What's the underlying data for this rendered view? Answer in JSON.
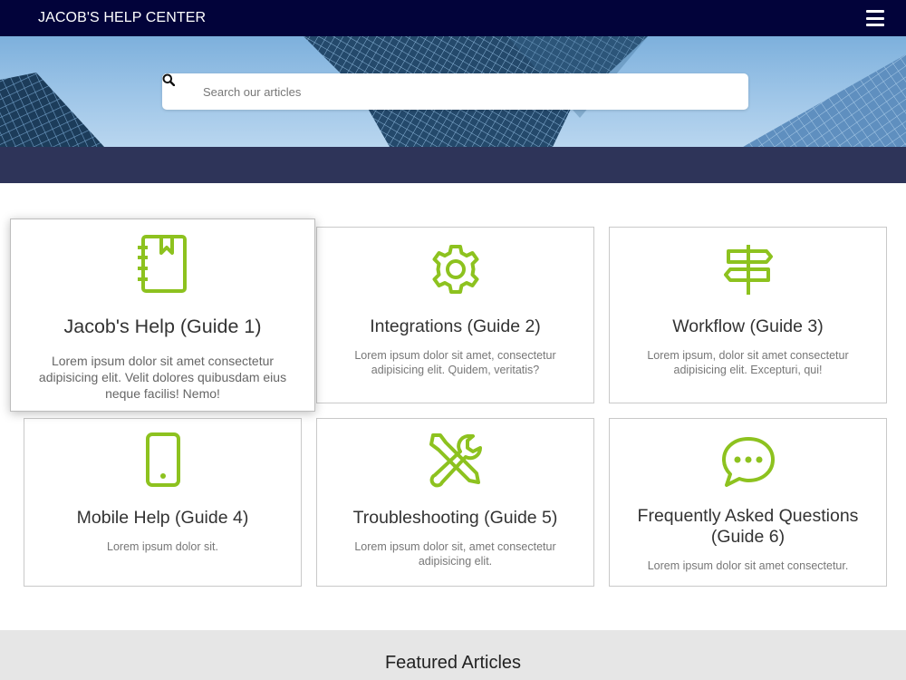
{
  "header": {
    "brand": "JACOB'S HELP CENTER",
    "menu_icon": "hamburger-menu-icon"
  },
  "search": {
    "placeholder": "Search our articles",
    "icon": "search-icon"
  },
  "colors": {
    "accent": "#8dc21f",
    "topbar": "#02033a",
    "band": "#2e3459",
    "featured_bg": "#e6e6e6"
  },
  "guides": [
    {
      "title": "Jacob's Help (Guide 1)",
      "desc": "Lorem ipsum dolor sit amet consectetur adipisicing elit. Velit dolores quibusdam eius neque facilis! Nemo!",
      "icon": "notebook-icon"
    },
    {
      "title": "Integrations (Guide 2)",
      "desc": "Lorem ipsum dolor sit amet, consectetur adipisicing elit. Quidem, veritatis?",
      "icon": "gear-icon"
    },
    {
      "title": "Workflow (Guide 3)",
      "desc": "Lorem ipsum, dolor sit amet consectetur adipisicing elit. Excepturi, qui!",
      "icon": "signpost-icon"
    },
    {
      "title": "Mobile Help (Guide 4)",
      "desc": "Lorem ipsum dolor sit.",
      "icon": "mobile-phone-icon"
    },
    {
      "title": "Troubleshooting (Guide 5)",
      "desc": "Lorem ipsum dolor sit, amet consectetur adipisicing elit.",
      "icon": "wrench-screwdriver-icon"
    },
    {
      "title": "Frequently Asked Questions (Guide 6)",
      "desc": "Lorem ipsum dolor sit amet consectetur.",
      "icon": "chat-bubble-icon"
    }
  ],
  "featured": {
    "title": "Featured Articles"
  }
}
